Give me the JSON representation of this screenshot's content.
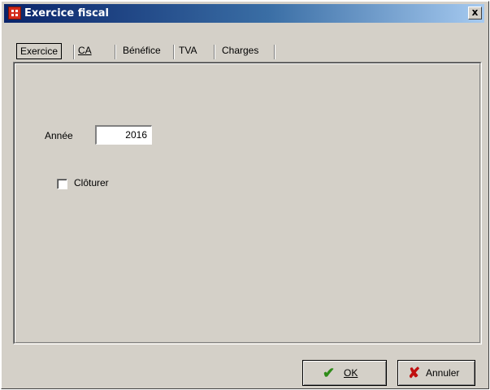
{
  "window": {
    "title": "Exercice fiscal",
    "close_glyph": "x"
  },
  "tabs": [
    {
      "label": "Exercice",
      "active": true
    },
    {
      "label": "CA",
      "active": false
    },
    {
      "label": "Bénéfice",
      "active": false
    },
    {
      "label": "TVA",
      "active": false
    },
    {
      "label": "Charges",
      "active": false
    }
  ],
  "form": {
    "year_label": "Année",
    "year_value": "2016",
    "close_checkbox_label": "Clôturer",
    "close_checkbox_checked": false
  },
  "buttons": {
    "ok_label": "OK",
    "cancel_label": "Annuler"
  },
  "icons": {
    "app": "app-window-icon",
    "ok": "check-icon",
    "cancel": "x-icon"
  },
  "colors": {
    "title_start": "#0a246a",
    "title_end": "#a6caf0",
    "face": "#d4d0c8",
    "ok_check": "#2e8b18",
    "cancel_x": "#c01010"
  }
}
